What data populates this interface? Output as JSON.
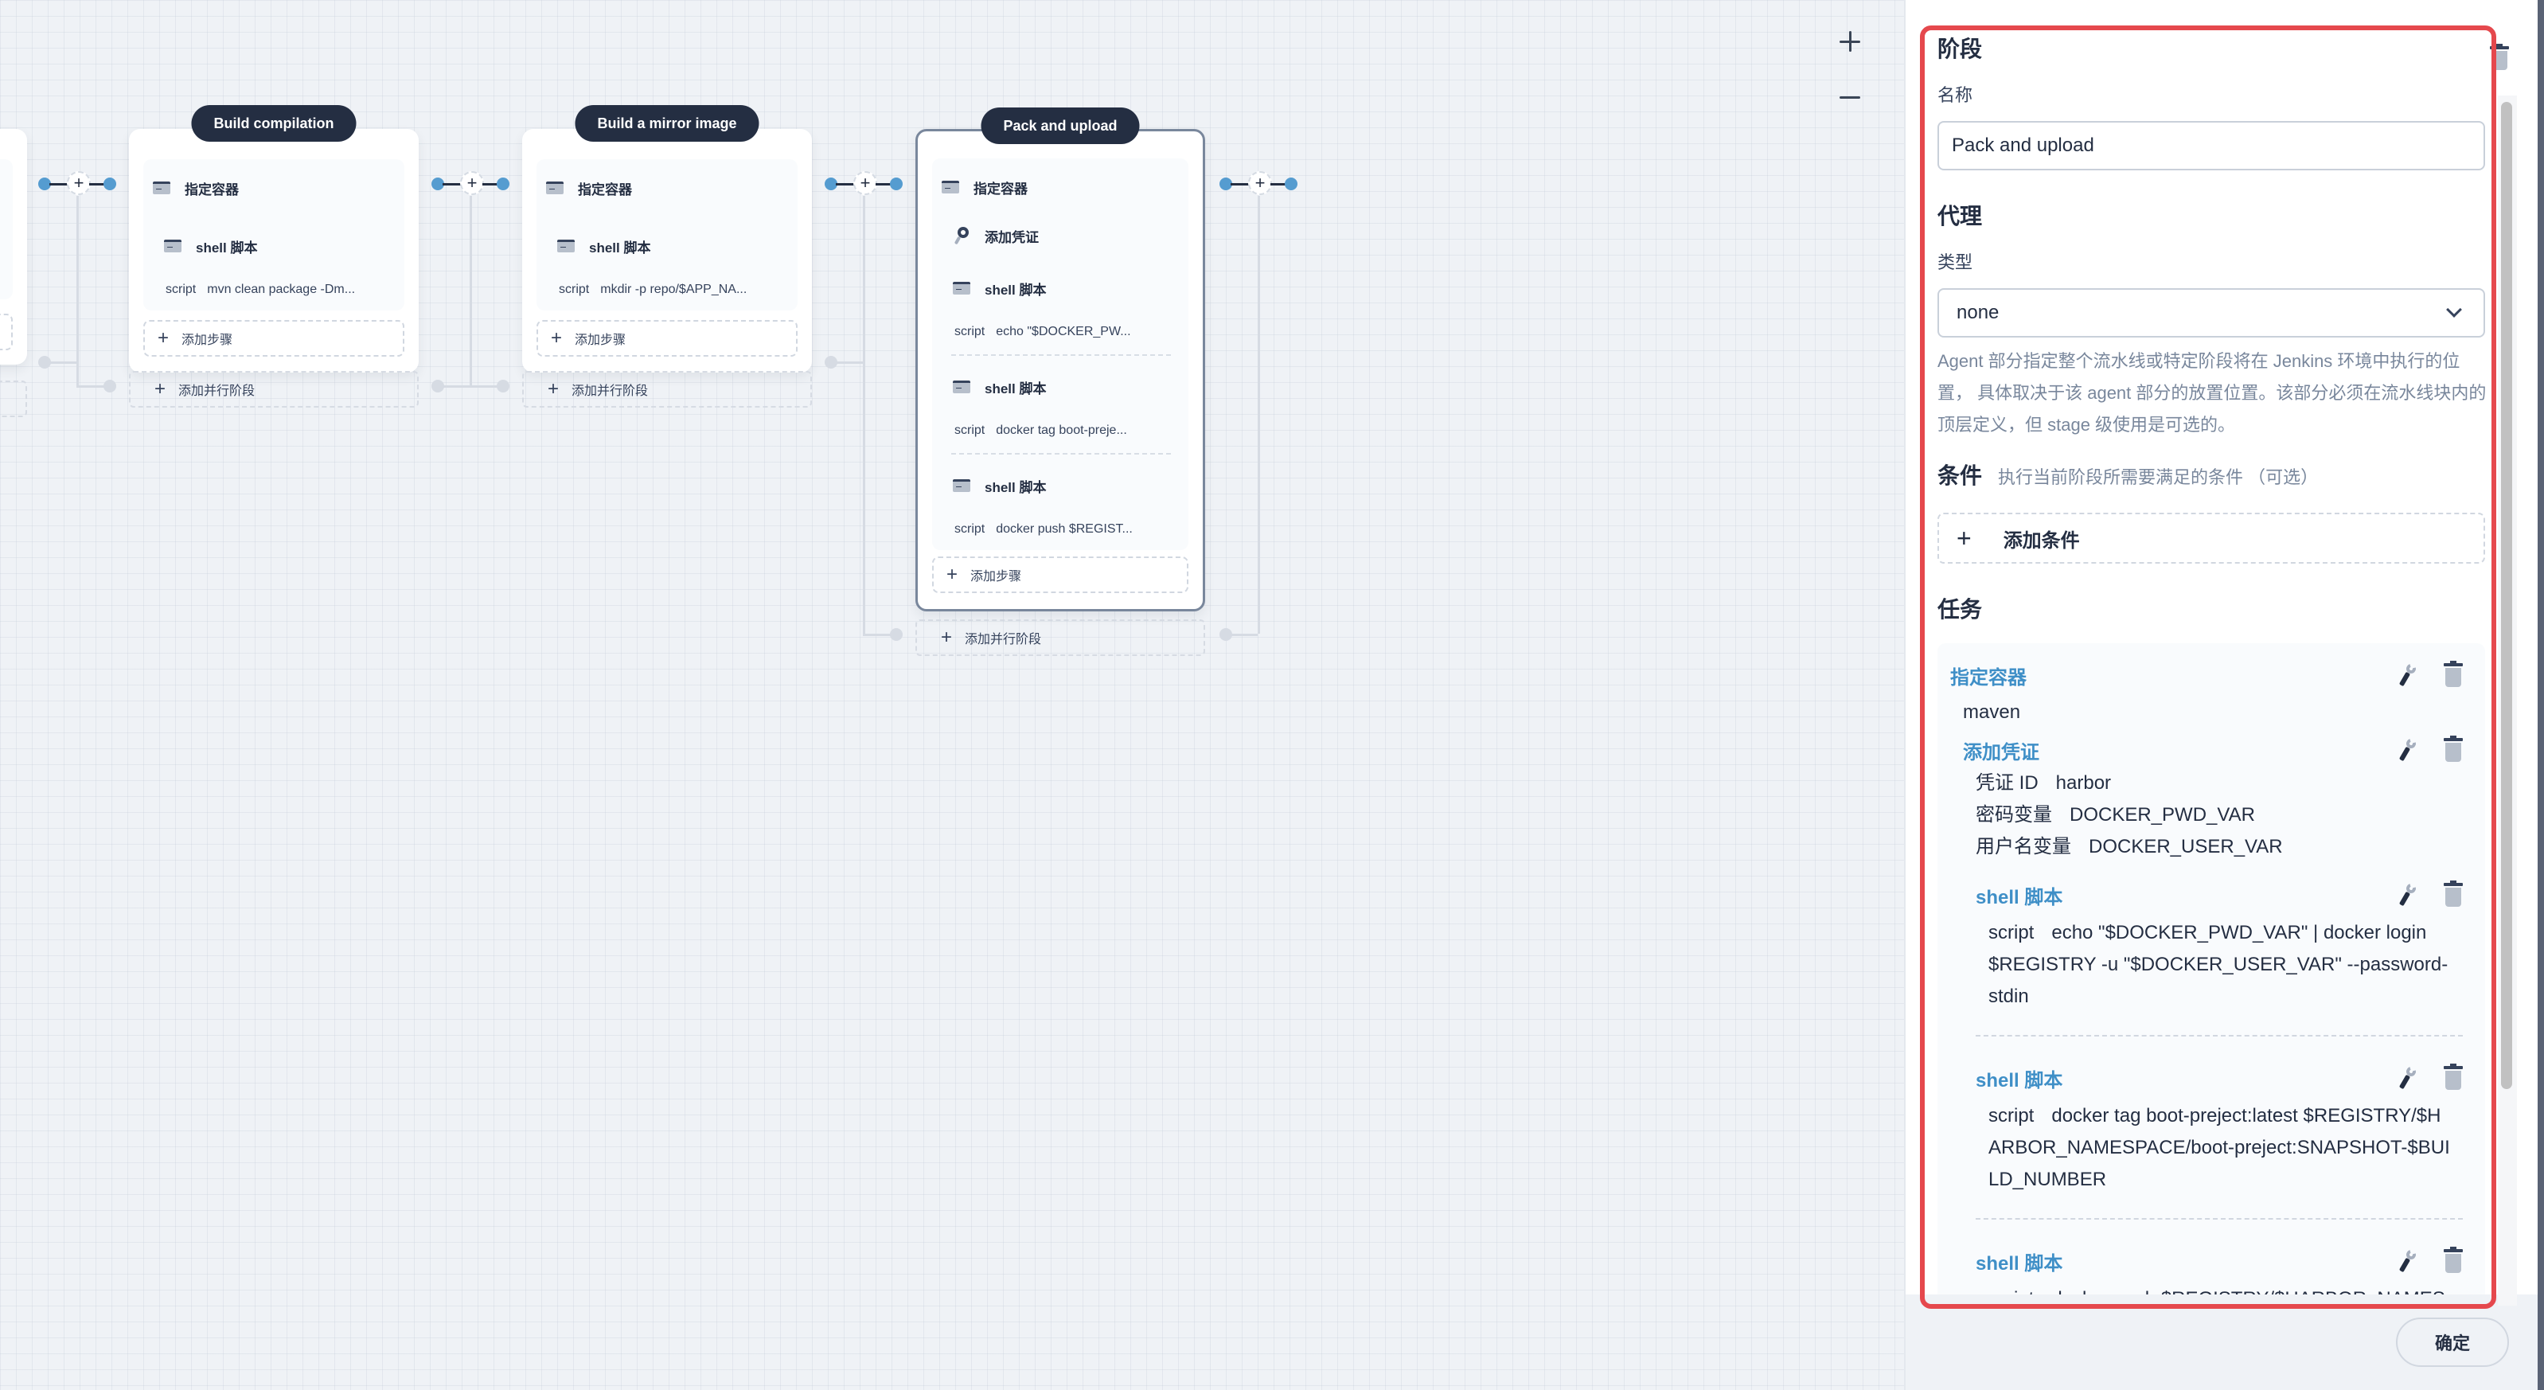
{
  "canvas": {
    "zoom_in_label": "+",
    "zoom_out_label": "−",
    "stages": [
      {
        "title": "Build compilation",
        "steps": [
          {
            "type": "container",
            "icon": "terminal-icon",
            "label": "指定容器"
          },
          {
            "type": "shell",
            "icon": "terminal-icon",
            "label": "shell 脚本",
            "script_key": "script",
            "script_value": "mvn clean package -Dm..."
          }
        ],
        "add_step_label": "添加步骤",
        "add_parallel_label": "添加并行阶段"
      },
      {
        "title": "Build a mirror image",
        "steps": [
          {
            "type": "container",
            "icon": "terminal-icon",
            "label": "指定容器"
          },
          {
            "type": "shell",
            "icon": "terminal-icon",
            "label": "shell 脚本",
            "script_key": "script",
            "script_value": "mkdir -p repo/$APP_NA..."
          }
        ],
        "add_step_label": "添加步骤",
        "add_parallel_label": "添加并行阶段"
      },
      {
        "title": "Pack and upload",
        "active": true,
        "steps": [
          {
            "type": "container",
            "icon": "terminal-icon",
            "label": "指定容器"
          },
          {
            "type": "credential",
            "icon": "key-icon",
            "label": "添加凭证"
          },
          {
            "type": "shell",
            "icon": "terminal-icon",
            "label": "shell 脚本",
            "script_key": "script",
            "script_value": "echo \"$DOCKER_PW..."
          },
          {
            "type": "shell",
            "icon": "terminal-icon",
            "label": "shell 脚本",
            "script_key": "script",
            "script_value": "docker tag boot-preje..."
          },
          {
            "type": "shell",
            "icon": "terminal-icon",
            "label": "shell 脚本",
            "script_key": "script",
            "script_value": "docker push $REGIST..."
          }
        ],
        "add_step_label": "添加步骤",
        "add_parallel_label": "添加并行阶段"
      }
    ],
    "connector_add_label": "+"
  },
  "drawer": {
    "stage_section_title": "阶段",
    "name_label": "名称",
    "name_value": "Pack and upload",
    "agent_section_title": "代理",
    "type_label": "类型",
    "type_value": "none",
    "agent_description": "Agent 部分指定整个流水线或特定阶段将在 Jenkins 环境中执行的位置， 具体取决于该 agent 部分的放置位置。该部分必须在流水线块内的顶层定义，但 stage 级使用是可选的。",
    "condition_title": "条件",
    "condition_hint": "执行当前阶段所需要满足的条件 （可选）",
    "add_condition_label": "添加条件",
    "tasks_title": "任务",
    "tasks": {
      "container": {
        "name": "指定容器",
        "value": "maven"
      },
      "credential": {
        "name": "添加凭证",
        "fields": [
          {
            "key": "凭证 ID",
            "value": "harbor"
          },
          {
            "key": "密码变量",
            "value": "DOCKER_PWD_VAR"
          },
          {
            "key": "用户名变量",
            "value": "DOCKER_USER_VAR"
          }
        ]
      },
      "shells": [
        {
          "name": "shell 脚本",
          "script_key": "script",
          "script_value": "echo \"$DOCKER_PWD_VAR\" | docker login $REGISTRY -u \"$DOCKER_USER_VAR\" --password-stdin"
        },
        {
          "name": "shell 脚本",
          "script_key": "script",
          "script_value": "docker tag boot-preject:latest $REGISTRY/$HARBOR_NAMESPACE/boot-preject:SNAPSHOT-$BUILD_NUMBER"
        },
        {
          "name": "shell 脚本",
          "script_key": "script",
          "script_value": "docker push $REGISTRY/$HARBOR_NAMES"
        }
      ]
    },
    "confirm_label": "确定"
  },
  "colors": {
    "accent_blue": "#3f8fc7",
    "node_dot": "#559cd0",
    "title_pill": "#242e42",
    "annotation_red": "#e5484d"
  }
}
